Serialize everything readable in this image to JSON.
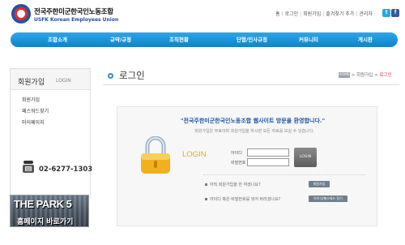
{
  "header": {
    "org_name_ko": "전국주한미군한국인노동조합",
    "org_name_en": "USFK Korean Employees Union",
    "util_links": [
      "홈",
      "로그인",
      "회원가입",
      "즐겨찾기 추가",
      "관리자"
    ],
    "social_icons": [
      "twitter-icon",
      "facebook-icon"
    ]
  },
  "nav": {
    "items": [
      "조합소개",
      "규약/규정",
      "조직현황",
      "단협/인사규정",
      "커뮤니티",
      "게시판"
    ]
  },
  "sidebar": {
    "title": "회원가입",
    "subtitle": "LOGIN",
    "items": [
      "회원가입",
      "패스워드찾기",
      "마이페이지"
    ],
    "phone": "02-6277-1303",
    "banner_title": "THE PARK 5",
    "banner_text": "홈페이지 바로가기"
  },
  "content": {
    "title": "로그인",
    "breadcrumb": {
      "home": "HOME",
      "section": "회원가입",
      "current": "로그인"
    }
  },
  "login": {
    "welcome_title": "\"전국주한미군한국인노동조합 웹사이트 방문을 환영합니다.\"",
    "welcome_sub": "회원가입은 무료이며 회원가입을 하시면 모든 자료를 보실 수 있습니다.",
    "login_label": "LOGIN",
    "id_label": "아이디",
    "pw_label": "비밀번호",
    "id_value": "",
    "pw_value": "",
    "login_button": "LOGIN",
    "help_join_text": "아직 회원가입을 안 하셨나요?",
    "help_join_button": "회원가입",
    "help_find_text": "아이디 혹은 비밀번호를 잊어 버리셨나요?",
    "help_find_button": "아이디/패스워드 찾기"
  },
  "colors": {
    "nav_blue": "#0d82cf",
    "brand_blue": "#1d56a6",
    "login_orange": "#e5a72a",
    "breadcrumb_red": "#d33333"
  }
}
